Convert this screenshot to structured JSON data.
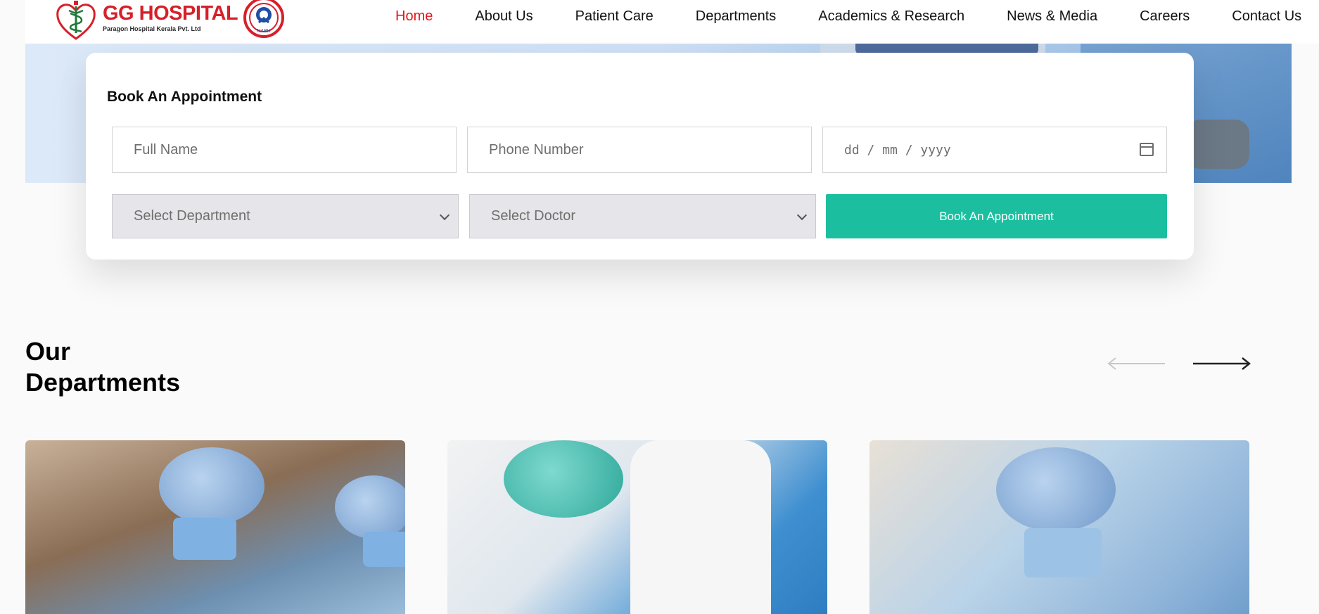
{
  "brand": {
    "name": "GG HOSPITAL",
    "tagline": "Paragon Hospital Kerala Pvt. Ltd",
    "badge": "NABH",
    "colors": {
      "brand_red": "#d6202a",
      "accent_teal": "#1bbf9f"
    }
  },
  "nav": {
    "items": [
      {
        "label": "Home",
        "active": true
      },
      {
        "label": "About Us",
        "active": false
      },
      {
        "label": "Patient Care",
        "active": false
      },
      {
        "label": "Departments",
        "active": false
      },
      {
        "label": "Academics & Research",
        "active": false
      },
      {
        "label": "News & Media",
        "active": false
      },
      {
        "label": "Careers",
        "active": false
      },
      {
        "label": "Contact Us",
        "active": false
      }
    ]
  },
  "appointment": {
    "title": "Book An Appointment",
    "full_name_placeholder": "Full Name",
    "phone_placeholder": "Phone Number",
    "date_placeholder": "dd / mm / yyyy",
    "department_placeholder": "Select Department",
    "doctor_placeholder": "Select Doctor",
    "submit_label": "Book An Appointment"
  },
  "departments": {
    "heading_line1": "Our",
    "heading_line2": "Departments",
    "prev_icon": "arrow-left-icon",
    "next_icon": "arrow-right-icon"
  }
}
